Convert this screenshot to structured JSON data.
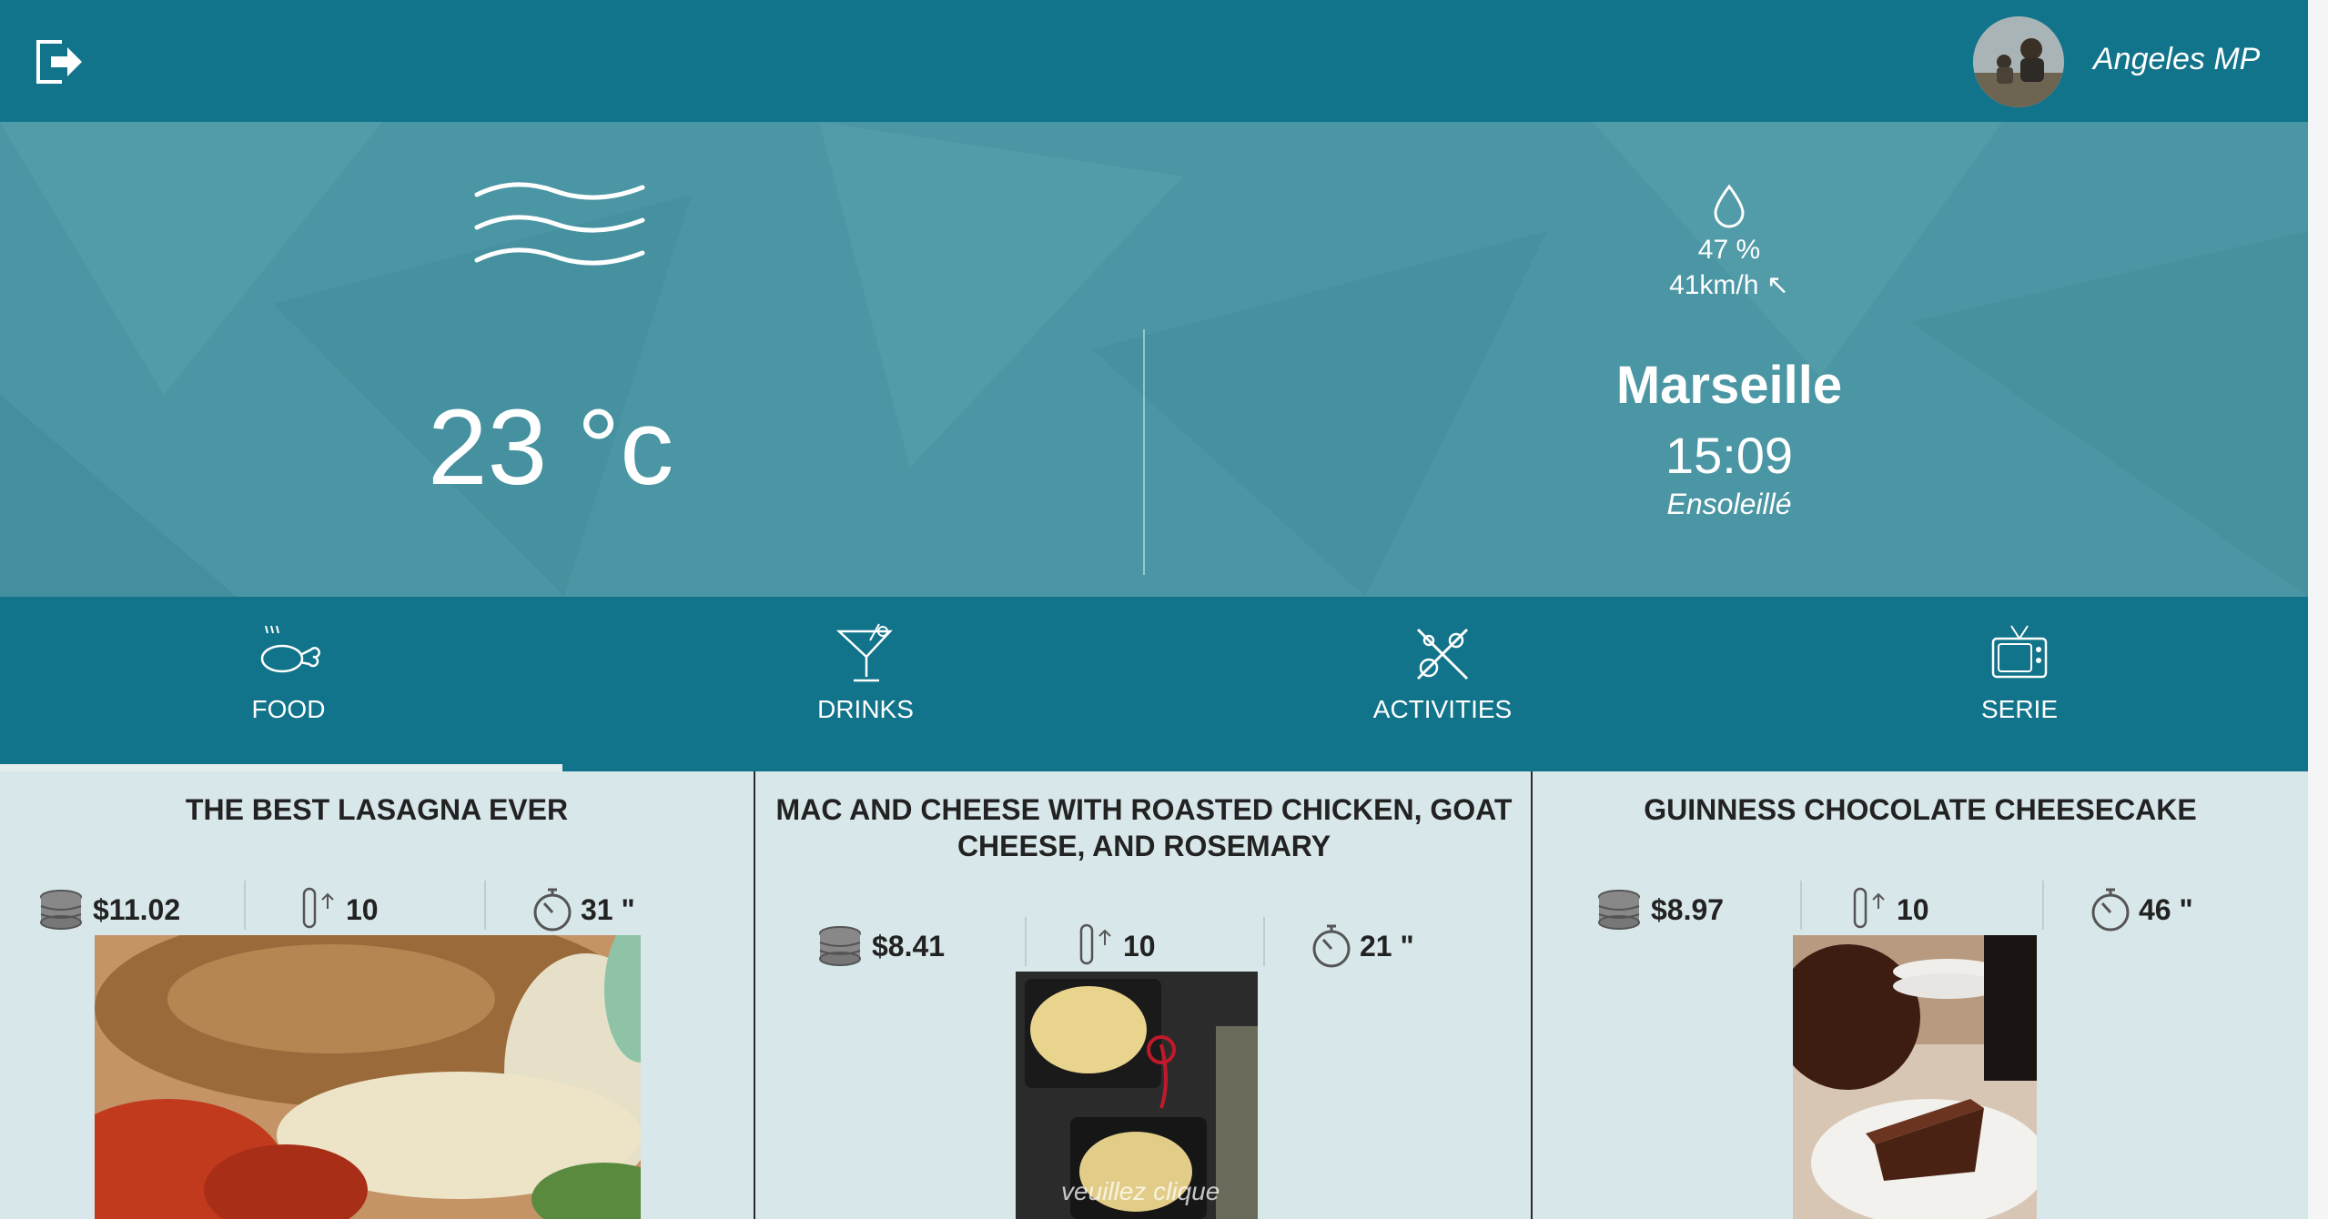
{
  "header": {
    "user_name": "Angeles MP",
    "logout_icon": "logout-icon",
    "avatar": "avatar"
  },
  "weather": {
    "icon": "wind-icon",
    "temperature": "23 °c",
    "humidity_icon": "drop-icon",
    "humidity": "47 %",
    "wind": "41km/h ↖",
    "city": "Marseille",
    "time": "15:09",
    "condition": "Ensoleillé"
  },
  "tabs": [
    {
      "label": "FOOD",
      "icon": "food-icon",
      "active": true
    },
    {
      "label": "DRINKS",
      "icon": "cocktail-icon",
      "active": false
    },
    {
      "label": "ACTIVITIES",
      "icon": "guitar-icon",
      "active": false
    },
    {
      "label": "SERIE",
      "icon": "tv-icon",
      "active": false
    }
  ],
  "recipes": [
    {
      "title": "THE BEST LASAGNA EVER",
      "price": "$11.02",
      "difficulty": "10",
      "time": "31 \""
    },
    {
      "title": "MAC AND CHEESE WITH ROASTED CHICKEN, GOAT CHEESE, AND ROSEMARY",
      "price": "$8.41",
      "difficulty": "10",
      "time": "21 \"",
      "image_overlay_text": "veuillez clique"
    },
    {
      "title": "GUINNESS CHOCOLATE CHEESECAKE",
      "price": "$8.97",
      "difficulty": "10",
      "time": "46 \""
    }
  ],
  "colors": {
    "header": "#11748b",
    "weather_bg": "#4b96a4",
    "card_bg": "#d8e7ea"
  }
}
